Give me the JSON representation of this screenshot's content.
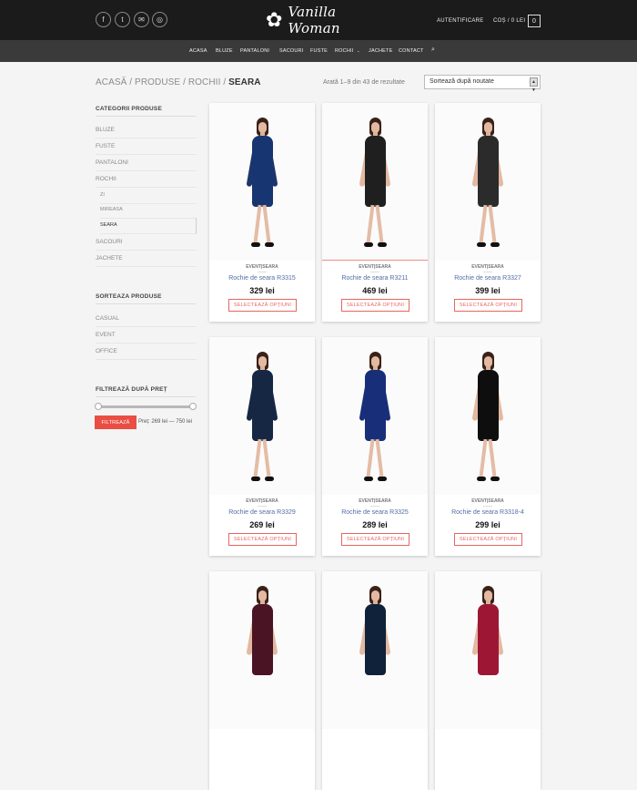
{
  "header": {
    "social_icons": [
      {
        "name": "facebook-icon",
        "glyph": "f"
      },
      {
        "name": "twitter-icon",
        "glyph": "t"
      },
      {
        "name": "email-icon",
        "glyph": "✉"
      },
      {
        "name": "instagram-icon",
        "glyph": "◎"
      }
    ],
    "logo_text": "Vanilla Woman",
    "auth_label": "AUTENTIFICARE",
    "cart_label": "COȘ / 0 LEI",
    "cart_count": "0"
  },
  "nav": {
    "items": [
      "ACASA",
      "BLUZE",
      "PANTALONI",
      "SACOURI",
      "FUSTE",
      "ROCHII",
      "JACHETE",
      "CONTACT"
    ]
  },
  "page": {
    "breadcrumb": {
      "home": "ACASĂ",
      "sep1": " / ",
      "products": "PRODUSE",
      "sep2": " / ",
      "category": "ROCHII",
      "sep3": " / ",
      "current": "SEARA"
    },
    "result_count": "Arată 1–9 din 43 de rezultate",
    "sort_value": "Sortează după noutate"
  },
  "sidebar": {
    "categories_title": "CATEGORII PRODUSE",
    "categories": [
      {
        "label": "BLUZE"
      },
      {
        "label": "FUSTE"
      },
      {
        "label": "PANTALONI"
      },
      {
        "label": "ROCHII"
      },
      {
        "label": "ZI"
      },
      {
        "label": "MIREASA"
      },
      {
        "label": "SEARA"
      },
      {
        "label": "SACOURI"
      },
      {
        "label": "JACHETE"
      }
    ],
    "sort_title": "SORTEAZA PRODUSE",
    "sort_items": [
      {
        "label": "CASUAL"
      },
      {
        "label": "EVENT"
      },
      {
        "label": "OFFICE"
      }
    ],
    "price_title": "FILTREAZĂ DUPĂ PREȚ",
    "filter_button": "FILTREAZĂ",
    "price_range": "Preț: 269 lei — 750 lei",
    "price_filter": {
      "min": 269,
      "max": 750
    }
  },
  "products": [
    {
      "category": "EVENT|SEARA",
      "name": "Rochie de seara R3315",
      "price": "329 lei",
      "button": "SELECTEAZĂ OPȚIUNI",
      "dress_color": "#173570",
      "arm_color": "#1d356b"
    },
    {
      "category": "EVENT|SEARA",
      "name": "Rochie de seara R3211",
      "price": "469 lei",
      "button": "SELECTEAZĂ OPȚIUNI",
      "dress_color": "#1f1f1f",
      "arm_color": "#e3b9a1"
    },
    {
      "category": "EVENT|SEARA",
      "name": "Rochie de seara R3327",
      "price": "399 lei",
      "button": "SELECTEAZĂ OPȚIUNI",
      "dress_color": "#2b2b2b",
      "arm_color": "#e3b9a1"
    },
    {
      "category": "EVENT|SEARA",
      "name": "Rochie de seara R3329",
      "price": "269 lei",
      "button": "SELECTEAZĂ OPȚIUNI",
      "dress_color": "#152743",
      "arm_color": "#152743"
    },
    {
      "category": "EVENT|SEARA",
      "name": "Rochie de seara R3325",
      "price": "289 lei",
      "button": "SELECTEAZĂ OPȚIUNI",
      "dress_color": "#182e78",
      "arm_color": "#182e78"
    },
    {
      "category": "EVENT|SEARA",
      "name": "Rochie de seara R3318-4",
      "price": "299 lei",
      "button": "SELECTEAZĂ OPȚIUNI",
      "dress_color": "#0e0e0e",
      "arm_color": "#e3b9a1"
    },
    {
      "dress_color": "#4b1425",
      "arm_color": "#e3b9a1"
    },
    {
      "dress_color": "#10213a",
      "arm_color": "#e3b9a1"
    },
    {
      "dress_color": "#9d1735",
      "arm_color": "#e3b9a1"
    }
  ]
}
